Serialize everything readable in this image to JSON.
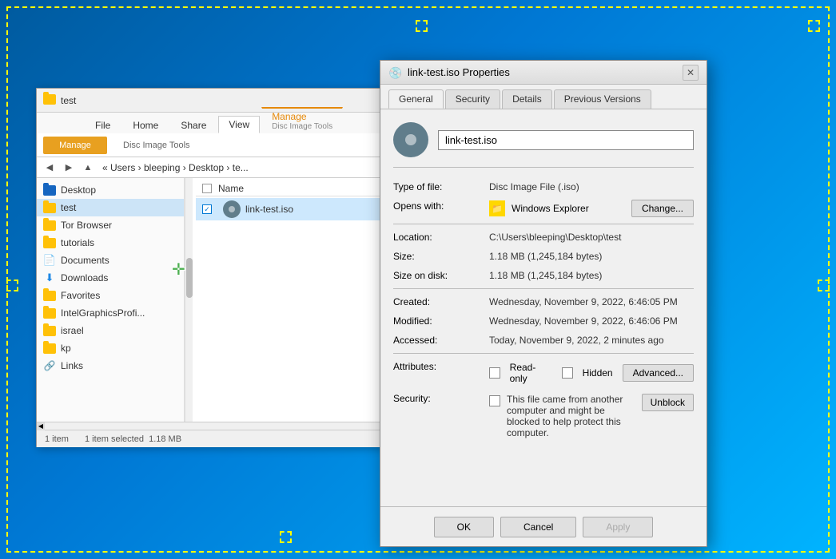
{
  "desktop": {
    "bg_color": "#0078d4"
  },
  "explorer": {
    "title": "test",
    "ribbon": {
      "tabs": [
        "File",
        "Home",
        "Share",
        "View"
      ],
      "active_tab": "View",
      "manage_label": "Manage",
      "disc_image_tools": "Disc Image Tools"
    },
    "address_bar": {
      "path": "« Users › bleeping › Desktop › te..."
    },
    "sidebar": {
      "items": [
        {
          "label": "Desktop",
          "type": "folder-dark-blue",
          "selected": false
        },
        {
          "label": "test",
          "type": "folder",
          "selected": true
        },
        {
          "label": "Tor Browser",
          "type": "folder",
          "selected": false
        },
        {
          "label": "tutorials",
          "type": "folder",
          "selected": false
        },
        {
          "label": "Documents",
          "type": "doc",
          "selected": false
        },
        {
          "label": "Downloads",
          "type": "download",
          "selected": false
        },
        {
          "label": "Favorites",
          "type": "folder",
          "selected": false
        },
        {
          "label": "IntelGraphicsProfi...",
          "type": "folder",
          "selected": false
        },
        {
          "label": "israel",
          "type": "folder",
          "selected": false
        },
        {
          "label": "kp",
          "type": "folder",
          "selected": false
        },
        {
          "label": "Links",
          "type": "links",
          "selected": false
        }
      ]
    },
    "files": [
      {
        "name": "link-test.iso",
        "selected": true,
        "checked": true
      }
    ],
    "status": {
      "item_count": "1 item",
      "selected": "1 item selected",
      "size": "1.18 MB"
    }
  },
  "properties_dialog": {
    "title": "link-test.iso Properties",
    "tabs": [
      {
        "label": "General",
        "active": true
      },
      {
        "label": "Security",
        "active": false
      },
      {
        "label": "Details",
        "active": false
      },
      {
        "label": "Previous Versions",
        "active": false
      }
    ],
    "file_name": "link-test.iso",
    "type_label": "Type of file:",
    "type_value": "Disc Image File (.iso)",
    "opens_label": "Opens with:",
    "opens_value": "Windows Explorer",
    "change_label": "Change...",
    "location_label": "Location:",
    "location_value": "C:\\Users\\bleeping\\Desktop\\test",
    "size_label": "Size:",
    "size_value": "1.18 MB (1,245,184 bytes)",
    "size_on_disk_label": "Size on disk:",
    "size_on_disk_value": "1.18 MB (1,245,184 bytes)",
    "created_label": "Created:",
    "created_value": "Wednesday, November 9, 2022, 6:46:05 PM",
    "modified_label": "Modified:",
    "modified_value": "Wednesday, November 9, 2022, 6:46:06 PM",
    "accessed_label": "Accessed:",
    "accessed_value": "Today, November 9, 2022, 2 minutes ago",
    "attributes_label": "Attributes:",
    "readonly_label": "Read-only",
    "hidden_label": "Hidden",
    "advanced_label": "Advanced...",
    "security_label": "Security:",
    "security_text": "This file came from another computer and might be blocked to help protect this computer.",
    "unblock_label": "Unblock",
    "footer": {
      "ok_label": "OK",
      "cancel_label": "Cancel",
      "apply_label": "Apply"
    }
  }
}
